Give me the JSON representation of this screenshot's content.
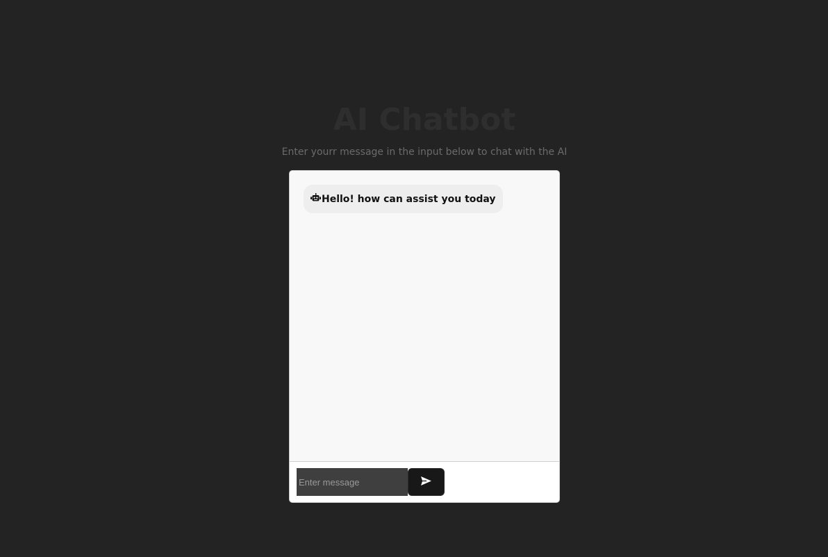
{
  "header": {
    "title": "AI Chatbot",
    "subtitle": "Enter yourr message in the input below to chat with the AI"
  },
  "chat": {
    "messages": [
      {
        "sender": "bot",
        "icon": "robot-icon",
        "text": "Hello! how can assist you today"
      }
    ]
  },
  "composer": {
    "value": "",
    "placeholder": "Enter message",
    "send_icon": "send-icon"
  },
  "colors": {
    "background": "#232323",
    "chat_area": "#f8f8f8",
    "bubble": "#eeeeee",
    "input": "#3f3f3f",
    "send_button": "#181818"
  }
}
